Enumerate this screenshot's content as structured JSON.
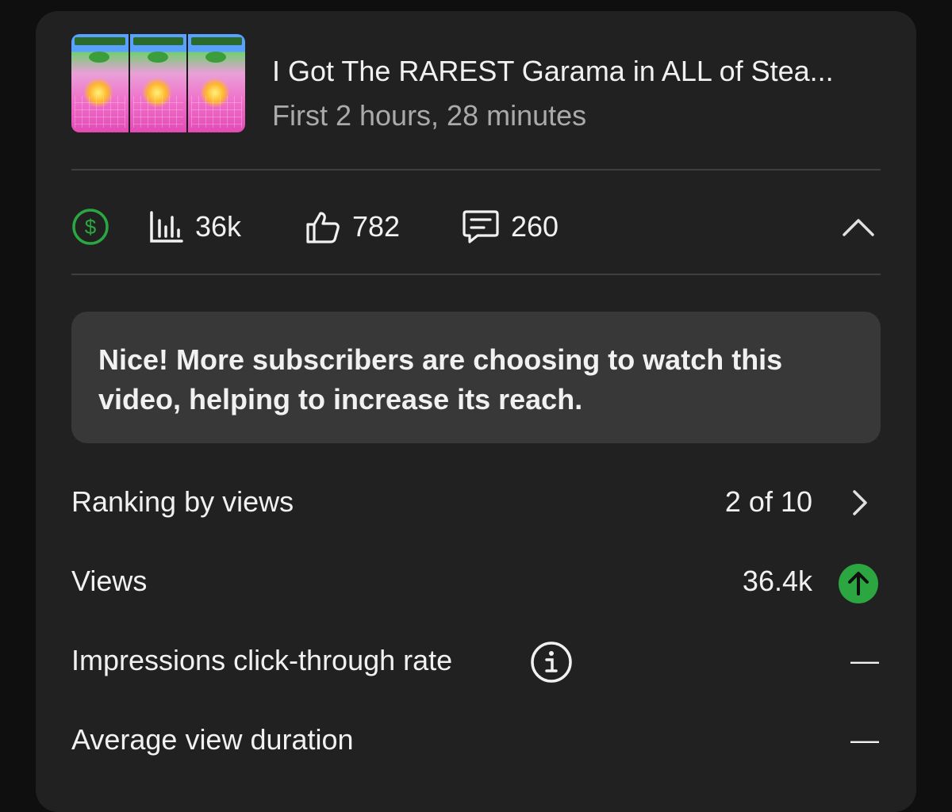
{
  "video": {
    "title": "I Got The RAREST Garama in ALL of Stea...",
    "subtitle": "First 2 hours, 28 minutes",
    "thumbnail_icon": "video-thumbnail"
  },
  "stats": {
    "monetization_icon": "dollar-circle-icon",
    "views_icon": "bar-chart-icon",
    "views": "36k",
    "likes_icon": "thumbs-up-icon",
    "likes": "782",
    "comments_icon": "comment-icon",
    "comments": "260",
    "collapse_icon": "chevron-up-icon"
  },
  "message": {
    "text": "Nice! More subscribers are choosing to watch this video, helping to increase its reach."
  },
  "metrics": [
    {
      "label": "Ranking by views",
      "value": "2 of 10",
      "icon": "chevron-right-icon"
    },
    {
      "label": "Views",
      "value": "36.4k",
      "icon": "arrow-up-circle-icon"
    },
    {
      "label": "Impressions click-through rate",
      "value": "—",
      "icon": "info-icon"
    },
    {
      "label": "Average view duration",
      "value": "—"
    }
  ],
  "colors": {
    "background": "#0f0f0f",
    "card": "#212121",
    "message_box": "#383838",
    "divider": "#3f3f3f",
    "text_primary": "#f1f1f1",
    "text_secondary": "#aaaaaa",
    "accent_green": "#2ba640"
  }
}
